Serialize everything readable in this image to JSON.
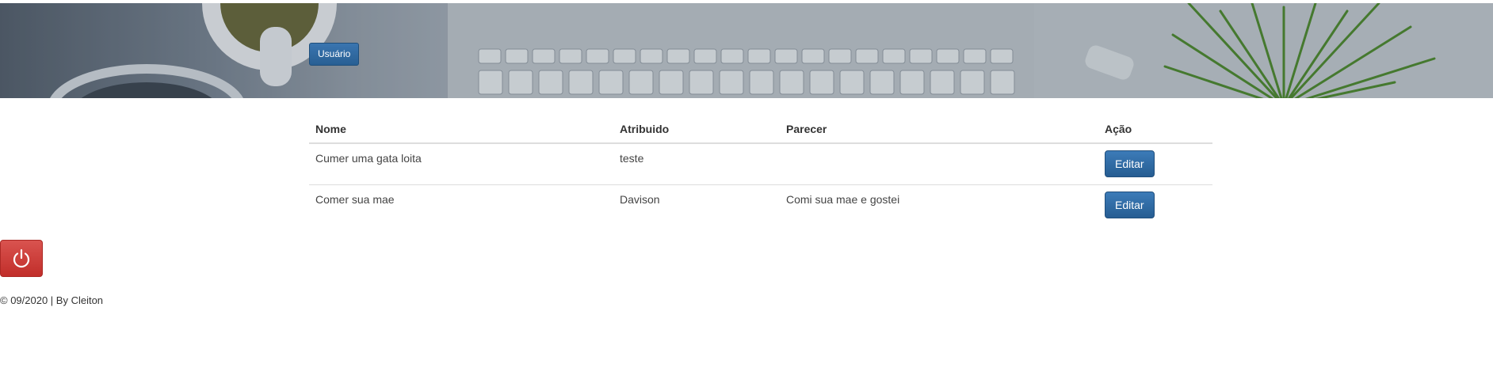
{
  "header": {
    "user_button_label": "Usuário"
  },
  "table": {
    "columns": [
      "Nome",
      "Atribuido",
      "Parecer",
      "Ação"
    ],
    "rows": [
      {
        "nome": "Cumer uma gata loita",
        "atribuido": "teste",
        "parecer": "",
        "action_label": "Editar"
      },
      {
        "nome": "Comer sua mae",
        "atribuido": "Davison",
        "parecer": "Comi sua mae e gostei",
        "action_label": "Editar"
      }
    ]
  },
  "logout": {
    "icon": "power-icon",
    "color": "#d9534f"
  },
  "footer": {
    "text": "© 09/2020 | By Cleiton"
  },
  "colors": {
    "primary": "#2d6ca2",
    "danger": "#d9534f"
  }
}
